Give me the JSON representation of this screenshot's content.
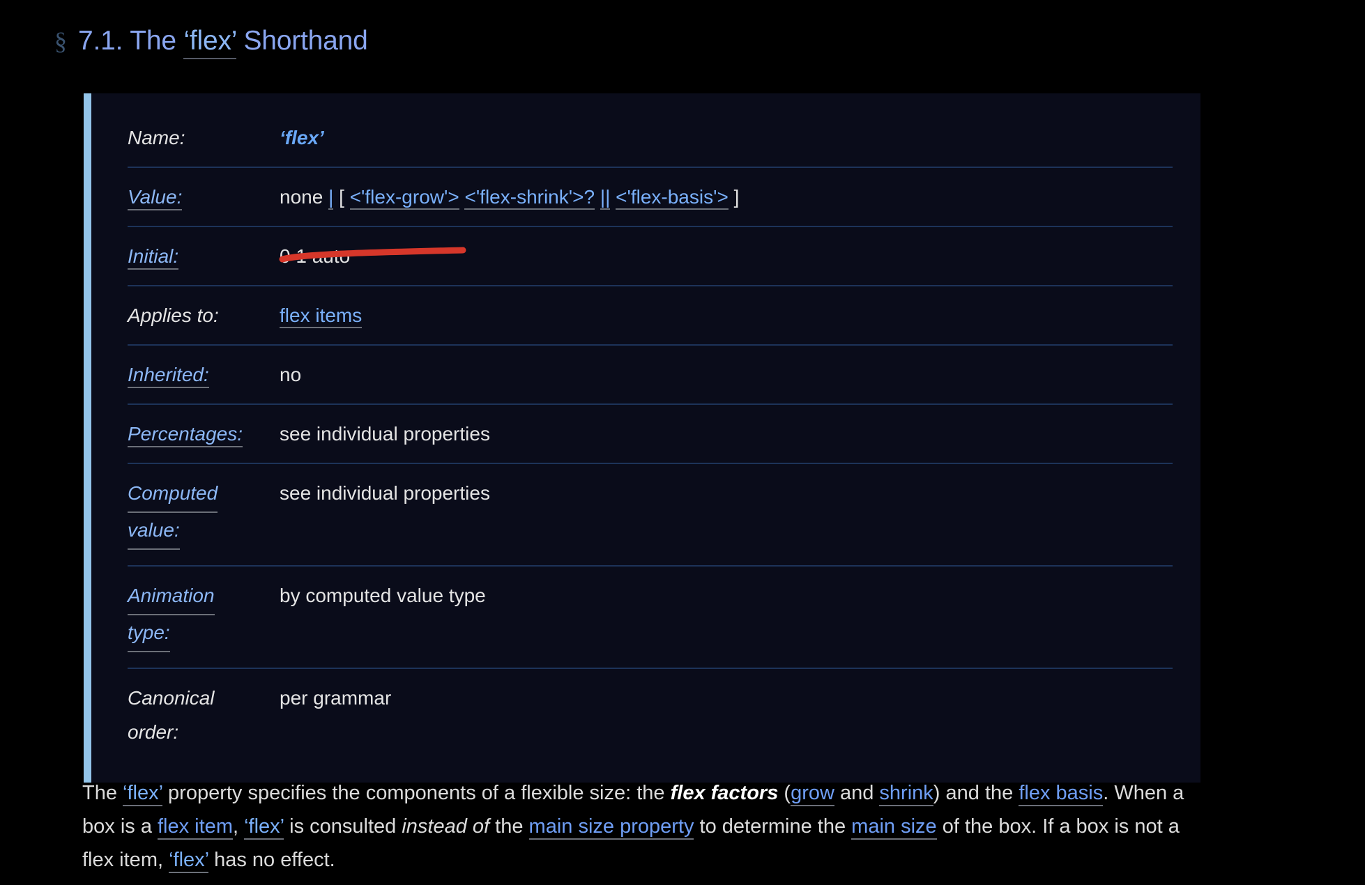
{
  "heading": {
    "section_mark": "§",
    "number": "7.1.",
    "the": "The",
    "property": "‘flex’",
    "suffix": "Shorthand"
  },
  "colors": {
    "page_background": "#000000",
    "panel_background": "#0a0c1a",
    "panel_accent_bar": "#93c5ea",
    "heading_blue": "#8aa6f0",
    "link_blue": "#7ab0fb",
    "row_divider": "#1d3359",
    "annotation_red": "#d6372a",
    "body_text": "#dcdcdc"
  },
  "propdef": {
    "rows": [
      {
        "key": "Name:",
        "key_is_link": false,
        "value_kind": "propname",
        "value": "‘flex’"
      },
      {
        "key": "Value:",
        "key_is_link": true,
        "value_kind": "grammar",
        "value": "none | [ <'flex-grow'> <'flex-shrink'>? || <'flex-basis'> ]",
        "grammar_parts": [
          {
            "text": "none",
            "type": "keyword"
          },
          {
            "text": "|",
            "type": "combinator"
          },
          {
            "text": "[",
            "type": "plain"
          },
          {
            "text": "<'flex-grow'>",
            "type": "link"
          },
          {
            "text": "<'flex-shrink'>?",
            "type": "link"
          },
          {
            "text": "||",
            "type": "combinator"
          },
          {
            "text": "<'flex-basis'>",
            "type": "link"
          },
          {
            "text": "]",
            "type": "plain"
          }
        ]
      },
      {
        "key": "Initial:",
        "key_is_link": true,
        "value_kind": "plain",
        "value": "0 1 auto",
        "annotated": true
      },
      {
        "key": "Applies to:",
        "key_is_link": false,
        "value_kind": "link",
        "value": "flex items"
      },
      {
        "key": "Inherited:",
        "key_is_link": true,
        "value_kind": "plain",
        "value": "no"
      },
      {
        "key": "Percentages:",
        "key_is_link": true,
        "value_kind": "plain",
        "value": "see individual properties"
      },
      {
        "key": "Computed value:",
        "key_lines": [
          "Computed",
          "value:"
        ],
        "key_is_link": true,
        "value_kind": "plain",
        "value": "see individual properties"
      },
      {
        "key": "Animation type:",
        "key_lines": [
          "Animation",
          "type:"
        ],
        "key_is_link": true,
        "value_kind": "plain",
        "value": "by computed value type"
      },
      {
        "key": "Canonical order:",
        "key_lines": [
          "Canonical",
          "order:"
        ],
        "key_is_link": false,
        "value_kind": "plain",
        "value": "per grammar"
      }
    ]
  },
  "annotation": {
    "type": "hand-drawn-underline",
    "color": "#d6372a",
    "targets_value": "0 1 auto"
  },
  "body_paragraph": {
    "segments": [
      {
        "text": "The ",
        "style": "plain"
      },
      {
        "text": "‘flex’",
        "style": "propname-link"
      },
      {
        "text": " property specifies the components of a flexible size: the ",
        "style": "plain"
      },
      {
        "text": "flex factors",
        "style": "bold-italic"
      },
      {
        "text": " (",
        "style": "plain"
      },
      {
        "text": "grow",
        "style": "link"
      },
      {
        "text": " and ",
        "style": "plain"
      },
      {
        "text": "shrink",
        "style": "link"
      },
      {
        "text": ") and the ",
        "style": "plain"
      },
      {
        "text": "flex basis",
        "style": "link"
      },
      {
        "text": ". When a box is a ",
        "style": "plain"
      },
      {
        "text": "flex item",
        "style": "link"
      },
      {
        "text": ", ",
        "style": "plain"
      },
      {
        "text": "‘flex’",
        "style": "propname-link"
      },
      {
        "text": " is consulted ",
        "style": "plain"
      },
      {
        "text": "instead of",
        "style": "italic"
      },
      {
        "text": " the ",
        "style": "plain"
      },
      {
        "text": "main size property",
        "style": "link"
      },
      {
        "text": " to determine the ",
        "style": "plain"
      },
      {
        "text": "main size",
        "style": "link"
      },
      {
        "text": " of the box. If a box is not a flex item, ",
        "style": "plain"
      },
      {
        "text": "‘flex’",
        "style": "propname-link"
      },
      {
        "text": " has no effect.",
        "style": "plain"
      }
    ]
  }
}
